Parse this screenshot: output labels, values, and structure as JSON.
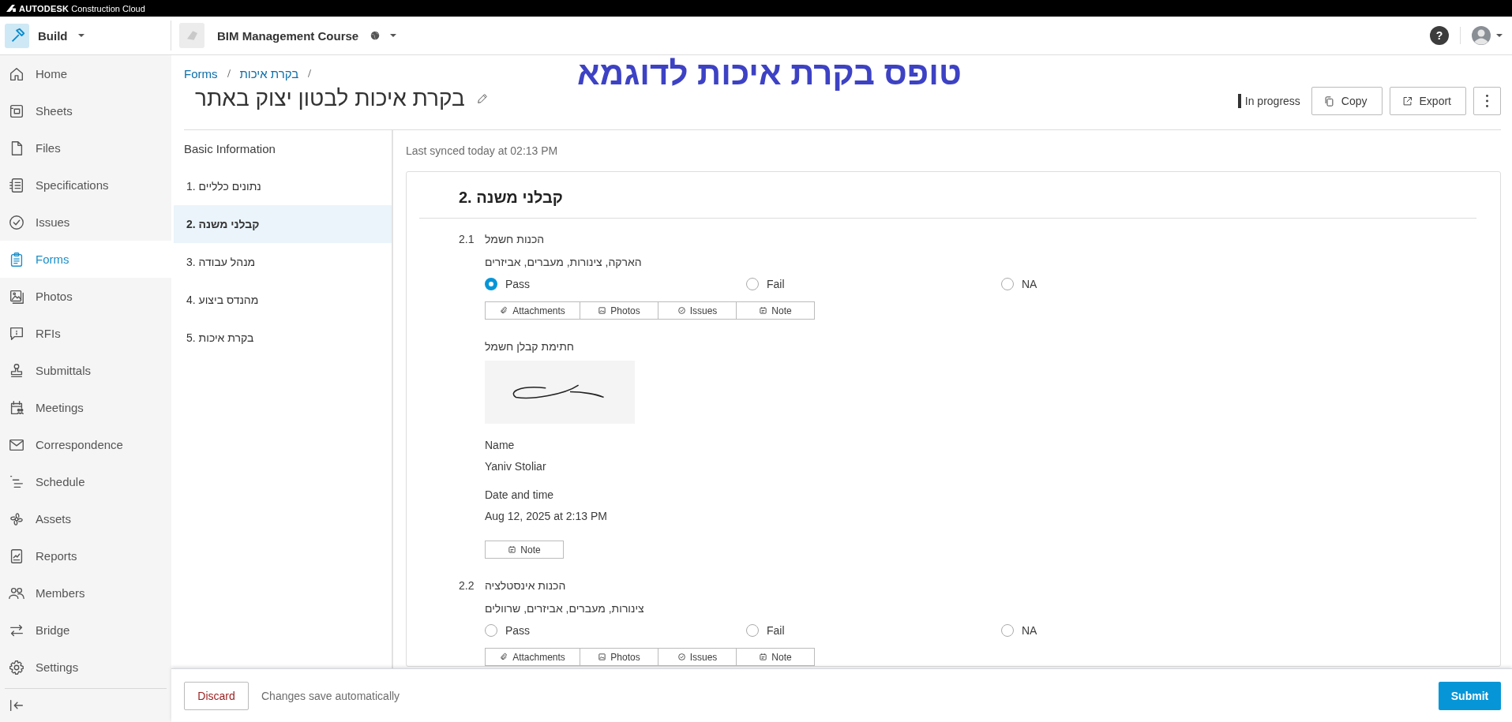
{
  "brand": {
    "company": "AUTODESK",
    "product": "Construction Cloud"
  },
  "module": "Build",
  "project": "BIM Management Course",
  "help": "?",
  "nav": [
    {
      "label": "Home",
      "selected": false
    },
    {
      "label": "Sheets",
      "selected": false
    },
    {
      "label": "Files",
      "selected": false
    },
    {
      "label": "Specifications",
      "selected": false
    },
    {
      "label": "Issues",
      "selected": false
    },
    {
      "label": "Forms",
      "selected": true
    },
    {
      "label": "Photos",
      "selected": false
    },
    {
      "label": "RFIs",
      "selected": false
    },
    {
      "label": "Submittals",
      "selected": false
    },
    {
      "label": "Meetings",
      "selected": false
    },
    {
      "label": "Correspondence",
      "selected": false
    },
    {
      "label": "Schedule",
      "selected": false
    },
    {
      "label": "Assets",
      "selected": false
    },
    {
      "label": "Reports",
      "selected": false
    },
    {
      "label": "Members",
      "selected": false
    },
    {
      "label": "Bridge",
      "selected": false
    },
    {
      "label": "Settings",
      "selected": false
    }
  ],
  "breadcrumb": [
    "Forms",
    "בקרת איכות"
  ],
  "title": "בקרת איכות לבטון יצוק באתר",
  "annotation": "טופס בקרת איכות לדוגמא",
  "status": "In progress",
  "actions": [
    "Copy",
    "Export"
  ],
  "sections_heading": "Basic Information",
  "sections": [
    {
      "label": "1. נתונים כלליים",
      "selected": false
    },
    {
      "label": "2. קבלני משנה",
      "selected": true
    },
    {
      "label": "3. מנהל עבודה",
      "selected": false
    },
    {
      "label": "4. מהנדס ביצוע",
      "selected": false
    },
    {
      "label": "5. בקרת איכות",
      "selected": false
    }
  ],
  "sync": "Last synced today at 02:13 PM",
  "section": {
    "heading": "2. קבלני משנה",
    "items": [
      {
        "number": "2.1",
        "label": "הכנות חשמל",
        "description": "הארקה, צינורות, מעברים, אביזרים",
        "options": [
          {
            "label": "Pass",
            "selected": true
          },
          {
            "label": "Fail",
            "selected": false
          },
          {
            "label": "NA",
            "selected": false
          }
        ],
        "tools": [
          {
            "label": "Attachments",
            "kind": "attachments"
          },
          {
            "label": "Photos",
            "kind": "photos"
          },
          {
            "label": "Issues",
            "kind": "issues"
          },
          {
            "label": "Note",
            "kind": "note"
          }
        ],
        "signature": {
          "label": "חתימת קבלן חשמל",
          "name_label": "Name",
          "name": "Yaniv Stoliar",
          "date_label": "Date and time",
          "date": "Aug 12, 2025 at 2:13 PM",
          "tools": [
            {
              "label": "Note",
              "kind": "note"
            }
          ]
        }
      },
      {
        "number": "2.2",
        "label": "הכנות אינסטלציה",
        "description": "צינורות, מעברים, אביזרים, שרוולים",
        "options": [
          {
            "label": "Pass",
            "selected": false
          },
          {
            "label": "Fail",
            "selected": false
          },
          {
            "label": "NA",
            "selected": false
          }
        ],
        "tools": [
          {
            "label": "Attachments",
            "kind": "attachments"
          },
          {
            "label": "Photos",
            "kind": "photos"
          },
          {
            "label": "Issues",
            "kind": "issues"
          },
          {
            "label": "Note",
            "kind": "note"
          }
        ]
      }
    ]
  },
  "footer": {
    "discard": "Discard",
    "note": "Changes save automatically",
    "submit": "Submit"
  }
}
